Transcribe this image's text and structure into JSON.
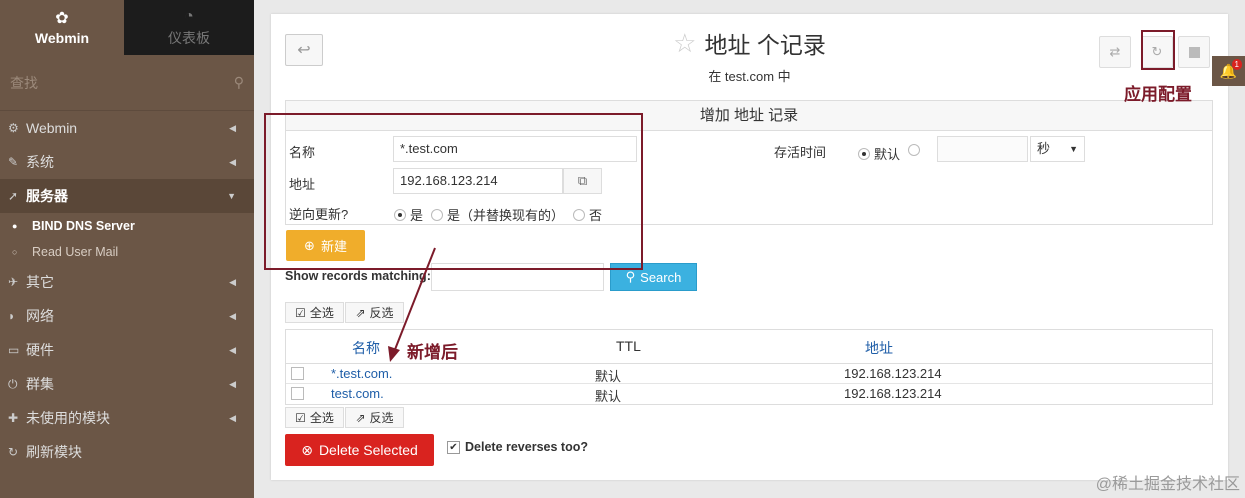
{
  "sidebar": {
    "tabs": [
      {
        "label": "Webmin",
        "icon": "webmin-logo-icon"
      },
      {
        "label": "仪表板",
        "icon": "dashboard-icon"
      }
    ],
    "search_placeholder": "查找",
    "items": [
      {
        "label": "Webmin",
        "icon": "gear-icon"
      },
      {
        "label": "系统",
        "icon": "wrench-icon"
      },
      {
        "label": "服务器",
        "icon": "rocket-icon"
      },
      {
        "label": "其它",
        "icon": "tools-icon"
      },
      {
        "label": "网络",
        "icon": "shield-icon"
      },
      {
        "label": "硬件",
        "icon": "hdd-icon"
      },
      {
        "label": "群集",
        "icon": "power-icon"
      },
      {
        "label": "未使用的模块",
        "icon": "puzzle-icon"
      },
      {
        "label": "刷新模块",
        "icon": "refresh-icon"
      }
    ],
    "subitems": [
      {
        "label": "BIND DNS Server"
      },
      {
        "label": "Read User Mail"
      }
    ]
  },
  "header": {
    "title": "地址 个记录",
    "subtitle": "在 test.com 中"
  },
  "form": {
    "heading": "增加 地址 记录",
    "name_label": "名称",
    "name_value": "*.test.com",
    "address_label": "地址",
    "address_value": "192.168.123.214",
    "reverse_label": "逆向更新?",
    "reverse_options": [
      "是",
      "是（并替换现有的）",
      "否"
    ],
    "ttl_label": "存活时间",
    "ttl_default": "默认",
    "ttl_unit": "秒",
    "new_button": "新建"
  },
  "search": {
    "label": "Show records matching:",
    "button": "Search"
  },
  "table_actions": {
    "select_all": "全选",
    "invert": "反选"
  },
  "table": {
    "columns": [
      "名称",
      "TTL",
      "地址"
    ],
    "rows": [
      {
        "name": "*.test.com.",
        "ttl": "默认",
        "address": "192.168.123.214"
      },
      {
        "name": "test.com.",
        "ttl": "默认",
        "address": "192.168.123.214"
      }
    ]
  },
  "footer": {
    "delete_button": "Delete Selected",
    "delete_reverses": "Delete reverses too?"
  },
  "annotations": {
    "apply_config": "应用配置",
    "after_new": "新增后"
  },
  "notification_count": "1",
  "watermark": "@稀土掘金技术社区",
  "colors": {
    "sidebar": "#6b5646",
    "new_button": "#f0ad2b",
    "search_button": "#3bb1e0",
    "delete_button": "#d9231f",
    "annotation": "#7c1b2a",
    "link": "#1f5ea8"
  }
}
